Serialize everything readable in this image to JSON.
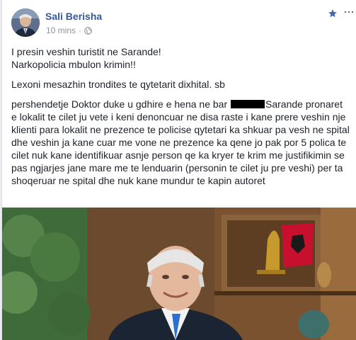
{
  "post": {
    "author": "Sali Berisha",
    "timestamp": "10 mins",
    "separator": "·",
    "globe_icon": "globe-icon",
    "star_icon": "star-icon",
    "more_icon": "more-options-icon"
  },
  "body": {
    "line1": "I presin veshin turistit ne Sarande!",
    "line2": "Narkopolicia mbulon krimin!!",
    "line3": "Lexoni mesazhin trondites te qytetarit dixhital. sb",
    "message_part1": "pershendetje Doktor duke u gdhire e hena ne bar ",
    "message_part2": "Sarande pronaret e lokalit te cilet ju vete i keni denoncuar ne disa raste i kane prere veshin nje klienti para lokalit ne prezence te policise qytetari ka shkuar pa vesh ne spital dhe veshin ja kane cuar me vone ne prezence ka qene jo pak por 5 polica te cilet nuk kane identifikuar asnje person qe ka kryer te krim me justifikimin se pas ngjarjes jane mare me te lenduarin (personin te cilet ju pre veshi) per ta shoqeruar ne spital dhe nuk kane mundur te kapin autoret"
  },
  "colors": {
    "author": "#365899",
    "meta": "#90949c",
    "text": "#1d2129",
    "star": "#4267b2"
  }
}
